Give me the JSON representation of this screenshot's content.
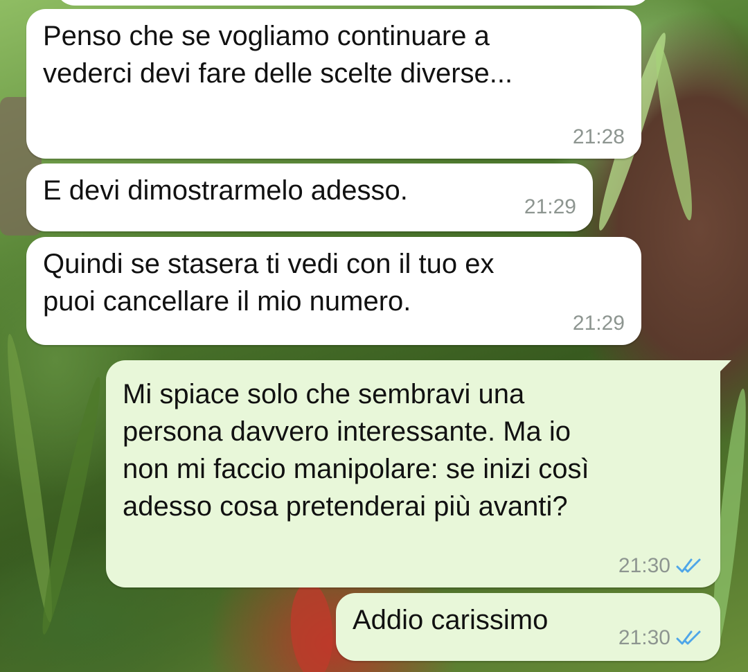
{
  "messages": [
    {
      "direction": "incoming",
      "lines": [
        "Penso che se vogliamo continuare a",
        "vederci devi fare delle scelte diverse..."
      ],
      "time": "21:28"
    },
    {
      "direction": "incoming",
      "lines": [
        "E devi dimostrarmelo adesso."
      ],
      "time": "21:29"
    },
    {
      "direction": "incoming",
      "lines": [
        "Quindi se stasera ti vedi con il tuo ex",
        "puoi cancellare il mio numero."
      ],
      "time": "21:29"
    },
    {
      "direction": "outgoing",
      "lines": [
        "Mi spiace solo che sembravi una",
        "persona davvero interessante. Ma io",
        "non mi faccio manipolare: se inizi così",
        "adesso cosa pretenderai più avanti?"
      ],
      "time": "21:30",
      "status_icon": "double-check-icon",
      "status_color": "#4fa6e8"
    },
    {
      "direction": "outgoing",
      "lines": [
        "Addio carissimo"
      ],
      "time": "21:30",
      "status_icon": "double-check-icon",
      "status_color": "#4fa6e8"
    }
  ]
}
